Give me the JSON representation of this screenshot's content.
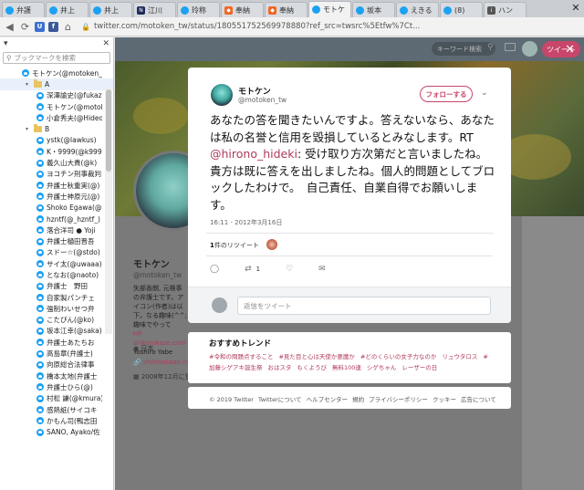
{
  "browser": {
    "tabs": [
      {
        "icon": "twitter-icon",
        "label": "弁護"
      },
      {
        "icon": "twitter-icon",
        "label": "井上"
      },
      {
        "icon": "twitter-icon",
        "label": "井上"
      },
      {
        "icon": "nikkei-icon",
        "label": "江川"
      },
      {
        "icon": "twitter-icon",
        "label": "玲称"
      },
      {
        "icon": "rss-icon",
        "label": "奉納"
      },
      {
        "icon": "rss-icon",
        "label": "奉納"
      },
      {
        "icon": "twitter-icon",
        "label": "モトケ",
        "active": true
      },
      {
        "icon": "twitter-icon",
        "label": "坂本"
      },
      {
        "icon": "twitter-icon",
        "label": "えきる"
      },
      {
        "icon": "twitter-icon",
        "label": "(8)"
      },
      {
        "icon": "ib-icon",
        "label": "ハン"
      }
    ],
    "url": "twitter.com/motoken_tw/status/180551752569978880?ref_src=twsrc%5Etfw%7Ct..."
  },
  "sidebar": {
    "search_placeholder": "ブックマークを検索",
    "items": [
      {
        "type": "bookmark",
        "indent": 1,
        "label": "モトケン(@motoken_tw)"
      },
      {
        "type": "folder",
        "indent": 1,
        "label": "A",
        "open": true,
        "selected": true
      },
      {
        "type": "bookmark",
        "indent": 2,
        "label": "深澤諭史(@fukazawas)"
      },
      {
        "type": "bookmark",
        "indent": 2,
        "label": "モトケン(@motoken_tw)"
      },
      {
        "type": "bookmark",
        "indent": 2,
        "label": "小倉秀夫(@Hideo_Ogura)"
      },
      {
        "type": "folder",
        "indent": 1,
        "label": "B",
        "open": true
      },
      {
        "type": "bookmark",
        "indent": 2,
        "label": "ystk(@lawkus)"
      },
      {
        "type": "bookmark",
        "indent": 2,
        "label": "K・9999(@k9999)"
      },
      {
        "type": "bookmark",
        "indent": 2,
        "label": "義久山大貴(@k)"
      },
      {
        "type": "bookmark",
        "indent": 2,
        "label": "ヨコチン刑事裁判"
      },
      {
        "type": "bookmark",
        "indent": 2,
        "label": "弁護士秋重実(@)"
      },
      {
        "type": "bookmark",
        "indent": 2,
        "label": "弁護士神原元(@)"
      },
      {
        "type": "bookmark",
        "indent": 2,
        "label": "Shoko Egawa(@)"
      },
      {
        "type": "bookmark",
        "indent": 2,
        "label": "hzntf(@_hzntf_)"
      },
      {
        "type": "bookmark",
        "indent": 2,
        "label": "落合洋司 ● Yoji"
      },
      {
        "type": "bookmark",
        "indent": 2,
        "label": "弁護士樋田晋吾"
      },
      {
        "type": "bookmark",
        "indent": 2,
        "label": "スドー☆(@stdo)"
      },
      {
        "type": "bookmark",
        "indent": 2,
        "label": "サイ太(@uwaaa)"
      },
      {
        "type": "bookmark",
        "indent": 2,
        "label": "となお(@naoto)"
      },
      {
        "type": "bookmark",
        "indent": 2,
        "label": "弁護士　野田"
      },
      {
        "type": "bookmark",
        "indent": 2,
        "label": "自家製パンチェ"
      },
      {
        "type": "bookmark",
        "indent": 2,
        "label": "強制わいせつ弁"
      },
      {
        "type": "bookmark",
        "indent": 2,
        "label": "こたぴん(@ko)"
      },
      {
        "type": "bookmark",
        "indent": 2,
        "label": "坂本江幸(@saka)"
      },
      {
        "type": "bookmark",
        "indent": 2,
        "label": "弁護士あたちお"
      },
      {
        "type": "bookmark",
        "indent": 2,
        "label": "高島章(弁護士)"
      },
      {
        "type": "bookmark",
        "indent": 2,
        "label": "向原総合法律事"
      },
      {
        "type": "bookmark",
        "indent": 2,
        "label": "橋本太地(弁護士"
      },
      {
        "type": "bookmark",
        "indent": 2,
        "label": "弁護士ひら(@)"
      },
      {
        "type": "bookmark",
        "indent": 2,
        "label": "村松 謙(@kmura)"
      },
      {
        "type": "bookmark",
        "indent": 2,
        "label": "感熱紙(サイコキ"
      },
      {
        "type": "bookmark",
        "indent": 2,
        "label": "かもん司(鴨志田"
      },
      {
        "type": "bookmark",
        "indent": 2,
        "label": "SANO, Ayako/佐"
      }
    ]
  },
  "twitter_page": {
    "search_placeholder": "キーワード検索",
    "tweet_button": "ツイート",
    "profile": {
      "name": "モトケン",
      "handle": "@motoken_tw",
      "bio": "矢部善朗, 元検事の弁護士です。アイコン(作者)は以下。なる趣味(^^; 趣味でやって",
      "bio_link": "HP shikinokaze.com",
      "bio_tail": "Yoshiro Yabe",
      "location": "日本",
      "url": "shikinokaze.com",
      "joined": "2008年12月に登録"
    }
  },
  "tweet": {
    "name": "モトケン",
    "handle": "@motoken_tw",
    "follow_label": "フォローする",
    "text_before": "あなたの答を聞きたいんですよ。答えないなら、あなたは私の名誉と信用を毀損しているとみなします。RT ",
    "mention": "@hirono_hideki",
    "text_after": ": 受け取り方次第だと言いましたね。貴方は既に答えを出しましたね。個人的問題としてブロックしたわけで。　自己責任、自業自得でお願いします。",
    "timestamp": "16:11 - 2012年3月16日",
    "retweet_count": "1",
    "retweet_label": "件のリツイート",
    "action_retweet_count": "1",
    "reply_placeholder": "返信をツイート"
  },
  "trends": {
    "title": "おすすめトレンド",
    "items": [
      "#令和の問題点すること",
      "#見た目と心は天使か悪魔か",
      "#どのくらいの女子力なのか",
      "リュウタロス",
      "#加藤シゲアキ誕生祭",
      "おはスタ",
      "もくようび",
      "無料100連",
      "シゲちゃん",
      "レーザーの日"
    ]
  },
  "footer": {
    "links": [
      "© 2019 Twitter",
      "Twitterについて",
      "ヘルプセンター",
      "規約",
      "プライバシーポリシー",
      "クッキー",
      "広告について"
    ]
  }
}
